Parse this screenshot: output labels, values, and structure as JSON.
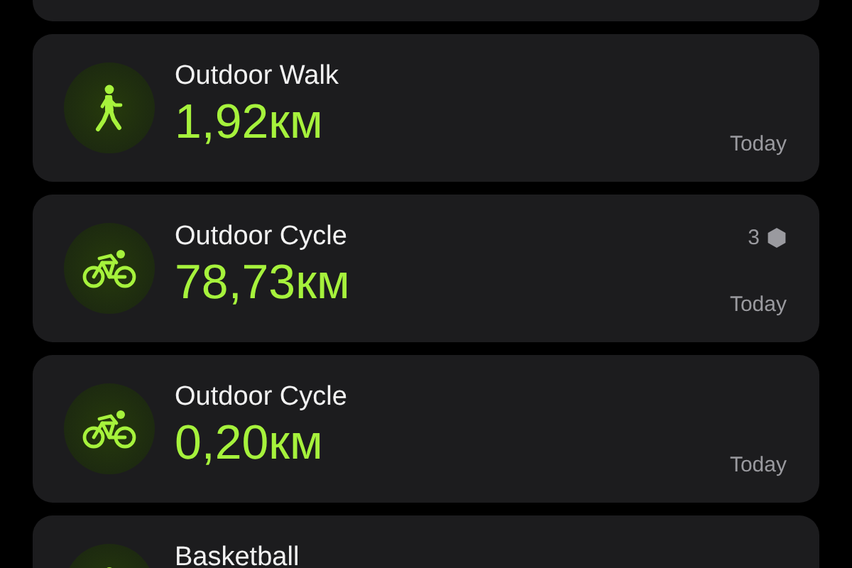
{
  "workouts": [
    {
      "kind": "walk",
      "name": "Outdoor Walk",
      "distance": "1,92км",
      "date": "Today"
    },
    {
      "kind": "cycle",
      "name": "Outdoor Cycle",
      "distance": "78,73км",
      "date": "Today",
      "badge": "3"
    },
    {
      "kind": "cycle",
      "name": "Outdoor Cycle",
      "distance": "0,20км",
      "date": "Today"
    },
    {
      "kind": "basketball",
      "name": "Basketball"
    }
  ]
}
